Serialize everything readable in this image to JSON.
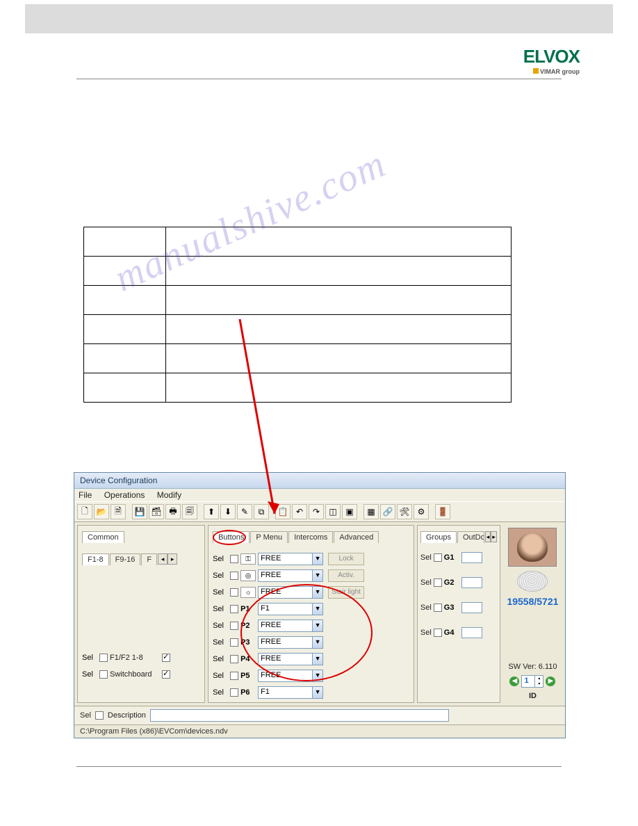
{
  "logo": {
    "brand": "ELVOX",
    "sub": "VIMAR group"
  },
  "watermark": "manualshive.com",
  "app": {
    "title": "Device Configuration",
    "menu": [
      "File",
      "Operations",
      "Modify"
    ],
    "left": {
      "topTab": "Common",
      "tabs": [
        "F1-8",
        "F9-16",
        "F"
      ],
      "row1_label": "Sel",
      "row1_name": "F1/F2 1-8",
      "row1_checked": true,
      "row2_label": "Sel",
      "row2_name": "Switchboard",
      "row2_checked": true
    },
    "mid": {
      "tabs": [
        "Buttons",
        "P Menu",
        "Intercoms",
        "Advanced"
      ],
      "rows": [
        {
          "sel": "Sel",
          "icon": "key-icon",
          "label": "",
          "value": "FREE",
          "btn": "Lock"
        },
        {
          "sel": "Sel",
          "icon": "eye-icon",
          "label": "",
          "value": "FREE",
          "btn": "Activ."
        },
        {
          "sel": "Sel",
          "icon": "light-icon",
          "label": "",
          "value": "FREE",
          "btn": "Stair light"
        },
        {
          "sel": "Sel",
          "icon": "",
          "label": "P1",
          "value": "F1",
          "btn": ""
        },
        {
          "sel": "Sel",
          "icon": "",
          "label": "P2",
          "value": "FREE",
          "btn": ""
        },
        {
          "sel": "Sel",
          "icon": "",
          "label": "P3",
          "value": "FREE",
          "btn": ""
        },
        {
          "sel": "Sel",
          "icon": "",
          "label": "P4",
          "value": "FREE",
          "btn": ""
        },
        {
          "sel": "Sel",
          "icon": "",
          "label": "P5",
          "value": "FREE",
          "btn": ""
        },
        {
          "sel": "Sel",
          "icon": "",
          "label": "P6",
          "value": "F1",
          "btn": ""
        }
      ]
    },
    "groups": {
      "tabs": [
        "Groups",
        "OutDoor"
      ],
      "items": [
        {
          "sel": "Sel",
          "label": "G1"
        },
        {
          "sel": "Sel",
          "label": "G2"
        },
        {
          "sel": "Sel",
          "label": "G3"
        },
        {
          "sel": "Sel",
          "label": "G4"
        }
      ]
    },
    "right": {
      "part": "19558/5721",
      "sw": "SW Ver: 6.110",
      "id_label": "ID",
      "id_value": "1"
    },
    "desc": {
      "sel": "Sel",
      "label": "Description",
      "value": ""
    },
    "status": "C:\\Program Files (x86)\\EVCom\\devices.ndv"
  }
}
